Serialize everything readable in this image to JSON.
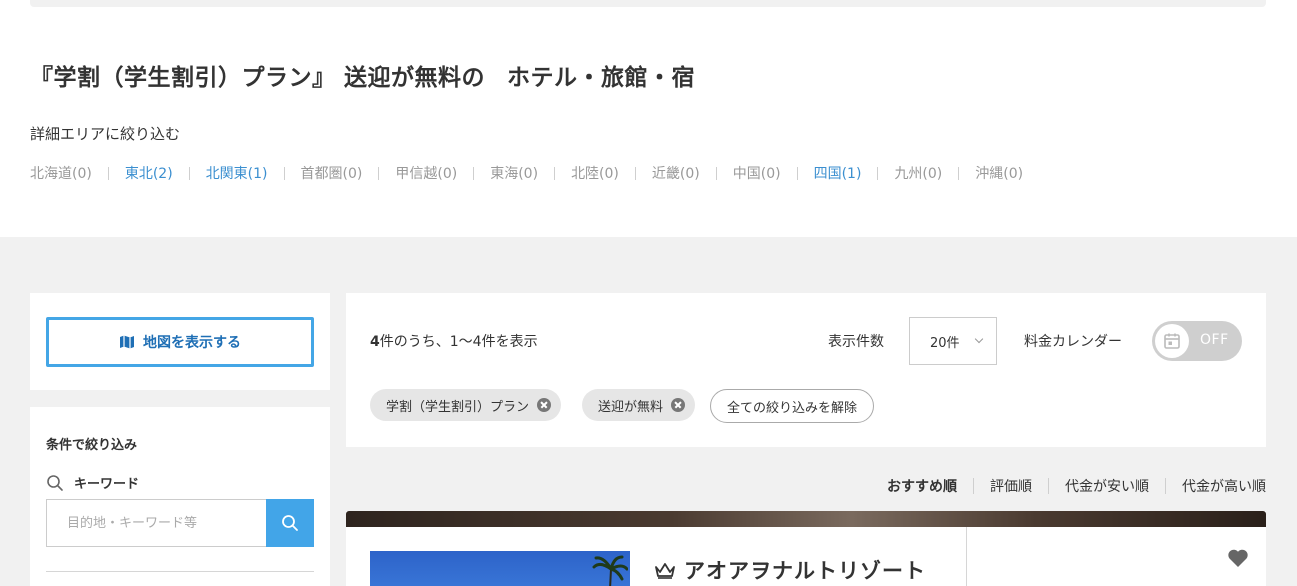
{
  "page": {
    "title_part1": "『学割（学生割引）プラン』 送迎が無料の",
    "title_part2": "ホテル・旅館・宿"
  },
  "area_filter": {
    "heading": "詳細エリアに絞り込む",
    "items": [
      {
        "label": "北海道(0)",
        "active": false
      },
      {
        "label": "東北(2)",
        "active": true
      },
      {
        "label": "北関東(1)",
        "active": true
      },
      {
        "label": "首都圏(0)",
        "active": false
      },
      {
        "label": "甲信越(0)",
        "active": false
      },
      {
        "label": "東海(0)",
        "active": false
      },
      {
        "label": "北陸(0)",
        "active": false
      },
      {
        "label": "近畿(0)",
        "active": false
      },
      {
        "label": "中国(0)",
        "active": false
      },
      {
        "label": "四国(1)",
        "active": true
      },
      {
        "label": "九州(0)",
        "active": false
      },
      {
        "label": "沖縄(0)",
        "active": false
      }
    ]
  },
  "sidebar": {
    "map_button": "地図を表示する",
    "filter_title": "条件で絞り込み",
    "keyword_label": "キーワード",
    "keyword_placeholder": "目的地・キーワード等"
  },
  "results": {
    "count_total": "4",
    "count_suffix": "件のうち、1〜4件を表示",
    "per_page_label": "表示件数",
    "per_page_value": "20件",
    "calendar_label": "料金カレンダー",
    "calendar_toggle": "OFF",
    "active_filters": [
      "学割（学生割引）プラン",
      "送迎が無料"
    ],
    "clear_all": "全ての絞り込みを解除"
  },
  "sort": {
    "options": [
      {
        "label": "おすすめ順",
        "active": true
      },
      {
        "label": "評価順",
        "active": false
      },
      {
        "label": "代金が安い順",
        "active": false
      },
      {
        "label": "代金が高い順",
        "active": false
      }
    ]
  },
  "hotel": {
    "name": "アオアヲナルトリゾート"
  },
  "colors": {
    "accent": "#42a5e8",
    "link": "#3b8fd0",
    "map_text": "#1f6fb5",
    "background": "#f1f1f1"
  }
}
